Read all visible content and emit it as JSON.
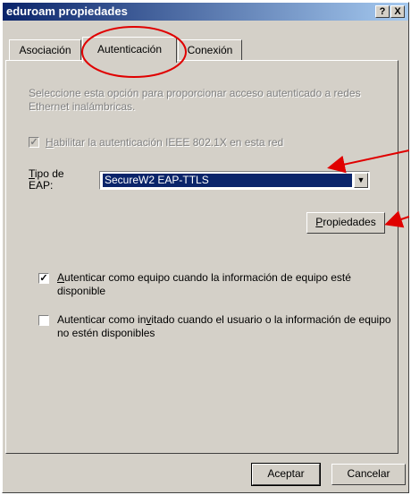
{
  "window": {
    "title": "eduroam propiedades",
    "help_btn": "?",
    "close_btn": "X"
  },
  "tabs": [
    {
      "label": "Asociación"
    },
    {
      "label": "Autenticación",
      "active": true
    },
    {
      "label": "Conexión"
    }
  ],
  "auth": {
    "description": "Seleccione esta opción para proporcionar acceso autenticado a redes Ethernet inalámbricas.",
    "enable_8021x": {
      "label_u": "H",
      "label_rest": "abilitar la autenticación IEEE 802.1X en esta red",
      "checked": true,
      "disabled": true
    },
    "eap_label_u": "T",
    "eap_label_rest1": "ipo de",
    "eap_label_rest2": "EAP:",
    "eap_type": "SecureW2 EAP-TTLS",
    "properties_u": "P",
    "properties_rest": "ropiedades",
    "as_computer": {
      "label_u": "A",
      "label_rest": "utenticar como equipo cuando la información de equipo esté disponible",
      "checked": true
    },
    "as_guest": {
      "label_pre": "Autenticar como in",
      "label_u": "v",
      "label_rest": "itado cuando el usuario o la información de equipo no estén disponibles",
      "checked": false
    }
  },
  "footer": {
    "ok": "Aceptar",
    "cancel": "Cancelar"
  },
  "colors": {
    "titlebar": "#0a246a",
    "face": "#d4d0c8",
    "annotation": "#e00000"
  }
}
